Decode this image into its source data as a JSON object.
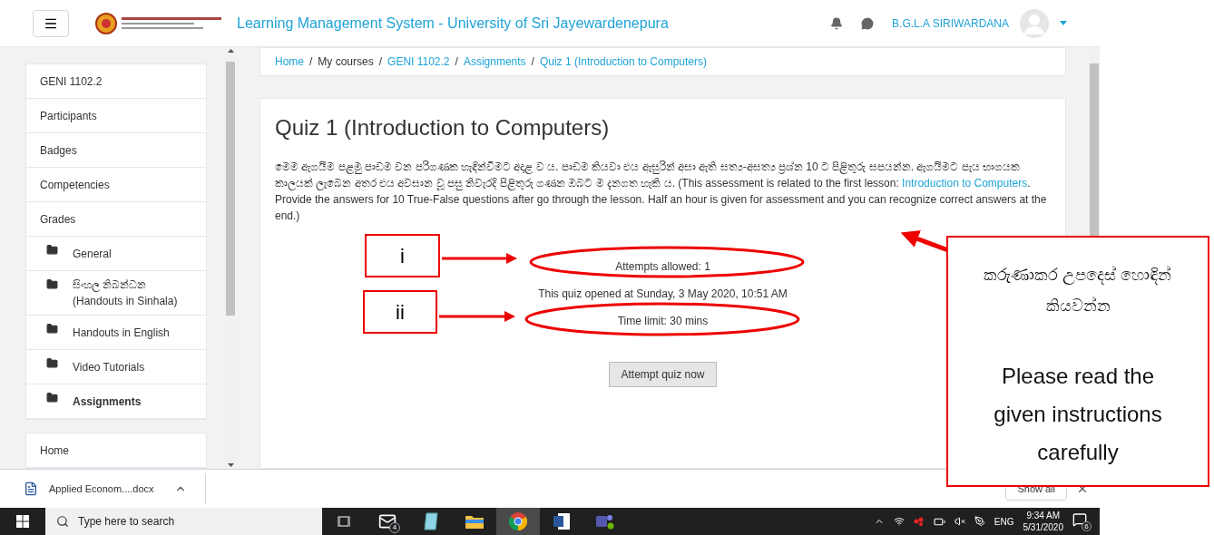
{
  "header": {
    "title": "Learning Management System - University of Sri Jayewardenepura",
    "user_name": "B.G.L.A SIRIWARDANA"
  },
  "breadcrumb": {
    "separator": "/",
    "items": [
      "Home",
      "My courses",
      "GENI 1102.2",
      "Assignments",
      "Quiz 1 (Introduction to Computers)"
    ]
  },
  "sidebar": {
    "sections": [
      {
        "items": [
          {
            "label": "GENI 1102.2",
            "kind": "link",
            "selected": false
          },
          {
            "label": "Participants",
            "kind": "link",
            "selected": false
          },
          {
            "label": "Badges",
            "kind": "link",
            "selected": false
          },
          {
            "label": "Competencies",
            "kind": "link",
            "selected": false
          },
          {
            "label": "Grades",
            "kind": "link",
            "selected": false
          },
          {
            "label": "General",
            "kind": "folder",
            "selected": false
          },
          {
            "label": "සිංහල නිබන්ධන (Handouts in Sinhala)",
            "kind": "folder",
            "selected": false
          },
          {
            "label": "Handouts in English",
            "kind": "folder",
            "selected": false
          },
          {
            "label": "Video Tutorials",
            "kind": "folder",
            "selected": false
          },
          {
            "label": "Assignments",
            "kind": "folder",
            "selected": true
          }
        ]
      },
      {
        "items": [
          {
            "label": "Home",
            "kind": "link",
            "selected": false
          }
        ]
      }
    ]
  },
  "quiz": {
    "title": "Quiz 1 (Introduction to Computers)",
    "description": {
      "before": "මෙම ඇගයීම පළමු පාඩම වන පරිගණක හැඳින්වීමට අදාළ ව ය. පාඩම කියවා එය ඇසුරින් අසා ඇති සත්‍ය-අසත්‍ය ප්‍රශ්න 10 ට පිළිතුරු සපයන්න. ඇගයීමට පැය භාගයක කාලයක් ලැබෙන අතර එය අවසාන වූ පසු නිවැරදි පිළිතුරු ගණන ඔබට ම දැනගත හැකි ය. (This assessment is related to the first lesson: ",
      "link": "Introduction to Computers",
      "after": ". Provide the answers for 10 True-False questions after go through the lesson. Half an hour is given for assessment and you can recognize correct answers at the end.)"
    },
    "info": [
      "Attempts allowed: 1",
      "This quiz opened at Sunday, 3 May 2020, 10:51 AM",
      "Time limit: 30 mins"
    ],
    "button": "Attempt quiz now"
  },
  "downloads": {
    "file": "Applied Econom....docx",
    "show_all": "Show all"
  },
  "taskbar": {
    "search_placeholder": "Type here to search",
    "apps": [
      {
        "kind": "taskview",
        "selected": false
      },
      {
        "kind": "mail",
        "badge": "4",
        "selected": false
      },
      {
        "kind": "notepad",
        "selected": false
      },
      {
        "kind": "folder",
        "selected": false
      },
      {
        "kind": "chrome",
        "selected": true
      },
      {
        "kind": "word",
        "selected": false
      },
      {
        "kind": "teams",
        "selected": false
      }
    ],
    "language": "ENG",
    "time": "9:34 AM",
    "date": "5/31/2020",
    "notifications": "6"
  },
  "annotations": {
    "labels": [
      "i",
      "ii"
    ],
    "note": [
      "කරුණාකර උපදෙස් හොඳින් කියවන්න",
      "Please read the given instructions carefully"
    ]
  }
}
